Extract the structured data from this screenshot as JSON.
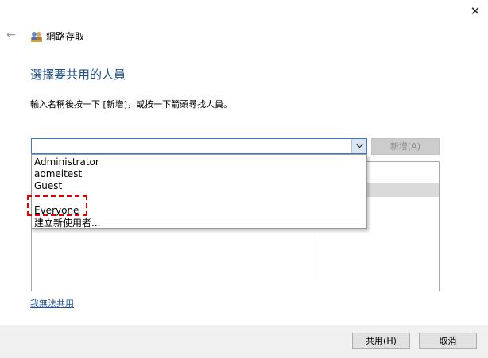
{
  "window": {
    "close_glyph": "✕"
  },
  "header": {
    "back_glyph": "←",
    "icon": "network-users-icon",
    "title": "網路存取"
  },
  "main": {
    "heading": "選擇要共用的人員",
    "instruction": "輸入名稱後按一下 [新增]，或按一下箭頭尋找人員。",
    "combo_value": "",
    "add_button": "新增(A)"
  },
  "dropdown": {
    "items": [
      {
        "label": "Administrator"
      },
      {
        "label": "aomeitest"
      },
      {
        "label": "Guest"
      },
      {
        "label": "Everyone"
      },
      {
        "label": "建立新使用者..."
      }
    ],
    "highlighted": "Everyone"
  },
  "links": {
    "cant_share": "我無法共用"
  },
  "footer": {
    "share_button": "共用(H)",
    "cancel_button": "取消"
  },
  "colors": {
    "heading": "#1e4d8b",
    "link": "#1e50a0",
    "highlight": "#e00000",
    "accent": "#3c78d8"
  }
}
